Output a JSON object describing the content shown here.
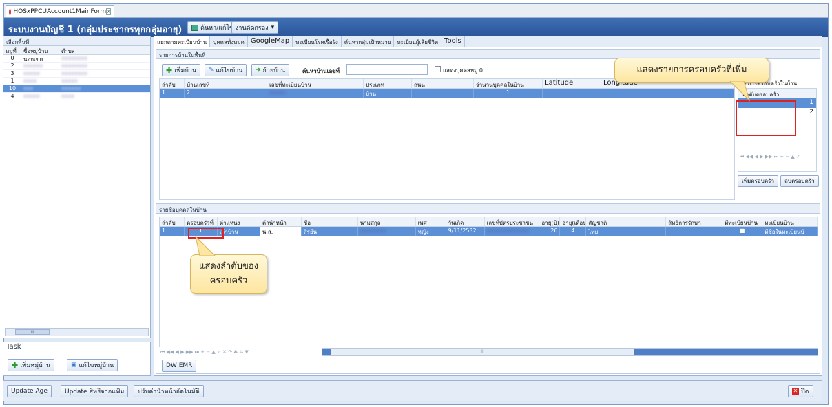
{
  "doc_tab": {
    "title": "HOSxPPCUAccount1MainForm",
    "close": "X"
  },
  "titlebar": {
    "title": "ระบบงานบัญชี 1 (กลุ่มประชากรทุกกลุ่มอายุ)",
    "search_btn": "ค้นหา/แก้ไข",
    "tasks_btn": "งานคัดกรอง"
  },
  "left": {
    "header": "เลือกพื้นที่",
    "cols": [
      "หมู่ที่",
      "ชื่อหมู่บ้าน",
      "ตำบล"
    ],
    "rows": [
      {
        "moo": "0",
        "name": "นอกเขต",
        "tambon": "xxxxxxxx"
      },
      {
        "moo": "2",
        "name": "xxxxxx",
        "tambon": "xxxxxxxx"
      },
      {
        "moo": "3",
        "name": "xxxxx",
        "tambon": "xxxxxxxx"
      },
      {
        "moo": "1",
        "name": "xxxx",
        "tambon": "xxxxx"
      },
      {
        "moo": "10",
        "name": "xxx",
        "tambon": "xxxxxx"
      },
      {
        "moo": "4",
        "name": "xxxxx",
        "tambon": "xxxx"
      }
    ],
    "scroll_thumb": "III",
    "task_label": "Task",
    "add_village_btn": "เพิ่มหมู่บ้าน",
    "edit_village_btn": "แก้ไขหมู่บ้าน"
  },
  "tabs": [
    "แยกตามทะเบียนบ้าน",
    "บุคคลทั้งหมด",
    "GoogleMap",
    "ทะเบียนโรคเรื้อรัง",
    "ค้นหากลุ่มเป้าหมาย",
    "ทะเบียนผู้เสียชีวิต",
    "Tools"
  ],
  "house": {
    "section_title": "รายการบ้านในพื้นที่",
    "add_btn": "เพิ่มบ้าน",
    "edit_btn": "แก้ไขบ้าน",
    "move_btn": "ย้ายบ้าน",
    "search_label": "ค้นหาบ้านเลขที่",
    "checkbox_label": "แสดงบุคคลหมู่ 0",
    "cols": [
      "ลำดับ",
      "บ้านเลขที่",
      "เลขที่ทะเบียนบ้าน",
      "ประเภท",
      "ถนน",
      "จำนวนบุคคลในบ้าน",
      "Latitude",
      "Longitude"
    ],
    "row": {
      "no": "1",
      "house_no": "2",
      "reg_no": "xxxxx",
      "type": "บ้าน",
      "road": "",
      "persons": "1",
      "lat": "",
      "lng": ""
    }
  },
  "family": {
    "title": "รายการครอบครัวในบ้าน",
    "col": "ลำดับครอบครัว",
    "rows": [
      "1",
      "2"
    ],
    "add_btn": "เพิ่มครอบครัว",
    "del_btn": "ลบครอบครัว",
    "nav": "⏮ ◀◀ ◀ ▶ ▶▶ ⏭ + − ▲ ✓"
  },
  "person": {
    "section_title": "รายชื่อบุคคลในบ้าน",
    "cols": [
      "ลำดับ",
      "ครอบครัวที่",
      "ตำแหน่ง",
      "คำนำหน้า",
      "ชื่อ",
      "นามสกุล",
      "เพศ",
      "วันเกิด",
      "เลขที่บัตรประชาชน",
      "อายุ(ปี)",
      "อายุ(เดือน)",
      "สัญชาติ",
      "สิทธิการรักษา",
      "มีทะเบียนบ้าน",
      "ทะเบียนบ้าน"
    ],
    "row": {
      "no": "1",
      "family": "1",
      "position": "เจ้าบ้าน",
      "prefix": "น.ส.",
      "name": "สิรยีน",
      "lname": "xxxxxxxx",
      "sex": "หญิง",
      "dob": "9/11/2532",
      "cid": "xxxxxxxxxxxxx",
      "age_y": "26",
      "age_m": "4",
      "nation": "ไทย",
      "right": "",
      "has_reg": "■",
      "reg": "มีชื่อในทะเบียนบ้"
    },
    "nav": "⏮ ◀◀ ◀ ▶ ▶▶ ⏭ + − ▲ ✓ ✕ ↷ ✱ ⇆ ▼",
    "scroll_thumb": "III",
    "dw_btn": "DW EMR"
  },
  "callouts": {
    "family_added": "แสดงรายการครอบครัวที่เพิ่ม",
    "family_order_1": "แสดงลำดับของ",
    "family_order_2": "ครอบครัว"
  },
  "bottom": {
    "update_age": "Update Age",
    "update_right": "Update สิทธิจากแฟ้ม",
    "adjust_prefix": "ปรับคำนำหน้าอัตโนมัติ",
    "close_btn": "ปิด"
  },
  "colors": {
    "accent": "#2a5599",
    "selection": "#5b8fd6",
    "highlight": "#dd2222",
    "callout": "#fde6a0"
  }
}
